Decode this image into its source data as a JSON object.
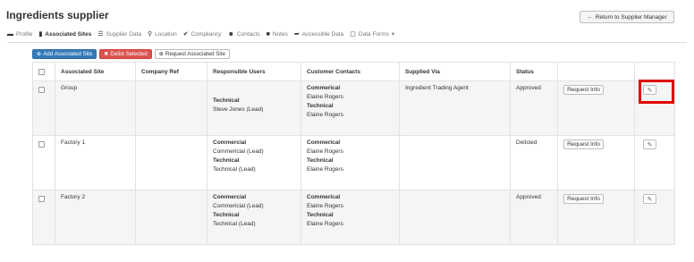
{
  "page": {
    "title": "Ingredients supplier",
    "return_label": "Return to Supplier Manager"
  },
  "tabs": [
    {
      "label": "Profile",
      "icon": "profile-icon"
    },
    {
      "label": "Associated Sites",
      "icon": "building-icon",
      "active": true
    },
    {
      "label": "Supplier Data",
      "icon": "list-icon"
    },
    {
      "label": "Location",
      "icon": "map-marker-icon"
    },
    {
      "label": "Compliancy",
      "icon": "checkmark-icon"
    },
    {
      "label": "Contacts",
      "icon": "users-icon"
    },
    {
      "label": "Notes",
      "icon": "notes-icon"
    },
    {
      "label": "Accessible Data",
      "icon": "share-icon"
    },
    {
      "label": "Data Forms",
      "icon": "form-icon"
    }
  ],
  "toolbar": {
    "add_label": "Add Associated Site",
    "delist_label": "Delist Selected",
    "request_label": "Request Associated Site"
  },
  "table": {
    "headers": [
      "Associated Site",
      "Company Ref",
      "Responsible Users",
      "Customer Contacts",
      "Supplied Via",
      "Status"
    ],
    "action_label": "Request Info",
    "rows": [
      {
        "site": "Group",
        "ref": "",
        "responsible": [
          "Technical",
          "Steve Jones (Lead)"
        ],
        "contacts": [
          "Commerical",
          "Elaine Rogers",
          "Technical",
          "Elaine Rogers"
        ],
        "via": "Ingredient Trading Agent",
        "status": "Approved"
      },
      {
        "site": "Factory 1",
        "ref": "",
        "responsible": [
          "Commercial",
          "Commericial (Lead)",
          "Technical",
          "Technical (Lead)"
        ],
        "contacts": [
          "Commerical",
          "Elaine Rogers",
          "Technical",
          "Elaine Rogers"
        ],
        "via": "",
        "status": "Delisted"
      },
      {
        "site": "Factory 2",
        "ref": "",
        "responsible": [
          "Commercial",
          "Commericial (Lead)",
          "Technical",
          "Technical (Lead)"
        ],
        "contacts": [
          "Commerical",
          "Elaine Rogers",
          "Technical",
          "Elaine Rogers"
        ],
        "via": "",
        "status": "Approved"
      }
    ]
  },
  "colors": {
    "primary": "#337ab7",
    "danger": "#d9534f",
    "highlight": "#e00000"
  }
}
